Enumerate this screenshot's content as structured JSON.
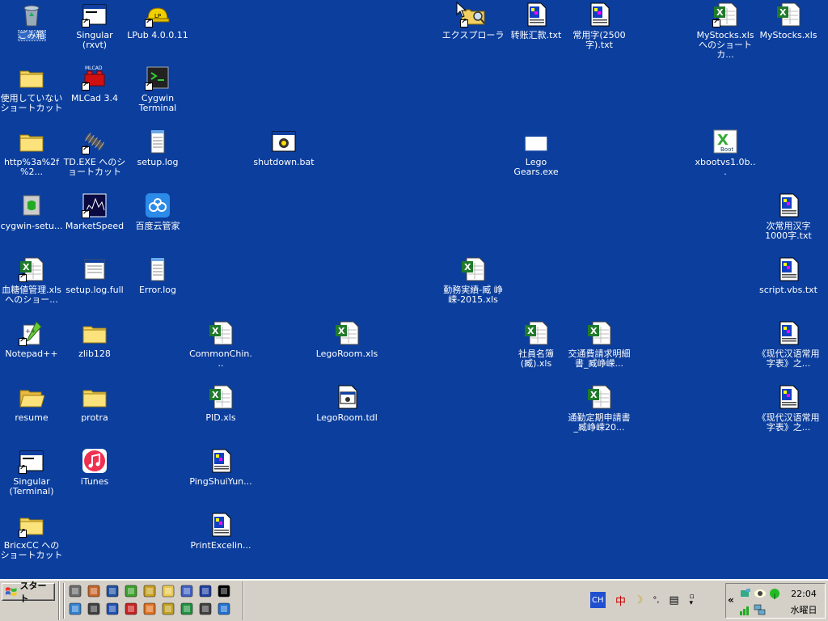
{
  "desktop": {
    "icons": [
      {
        "name": "recycle-bin",
        "label": "ごみ箱",
        "icon": "recycle-bin-icon",
        "col": 0,
        "row": 0,
        "shortcut": false,
        "selected": true
      },
      {
        "name": "singular-rxvt",
        "label": "Singular (rxvt)",
        "icon": "app-window-icon",
        "col": 1,
        "row": 0,
        "shortcut": true
      },
      {
        "name": "lpub",
        "label": "LPub 4.0.0.11",
        "icon": "hardhat-icon",
        "col": 2,
        "row": 0,
        "shortcut": true
      },
      {
        "name": "explorer",
        "label": "エクスプローラ",
        "icon": "explorer-icon",
        "col": 7,
        "row": 0,
        "shortcut": true
      },
      {
        "name": "zhuanzhang",
        "label": "转账汇款.txt",
        "icon": "text-doc-icon",
        "col": 8,
        "row": 0,
        "shortcut": false
      },
      {
        "name": "changyongzi",
        "label": "常用字(2500字).txt",
        "icon": "text-doc-icon",
        "col": 9,
        "row": 0,
        "shortcut": false
      },
      {
        "name": "mystocks-shortcut",
        "label": "MyStocks.xls へのショートカ...",
        "icon": "excel-doc-icon",
        "col": 11,
        "row": 0,
        "shortcut": true
      },
      {
        "name": "mystocks",
        "label": "MyStocks.xls",
        "icon": "excel-doc-icon",
        "col": 12,
        "row": 0,
        "shortcut": false
      },
      {
        "name": "unused-shortcuts",
        "label": "使用していないショートカット",
        "icon": "folder-icon",
        "col": 0,
        "row": 1,
        "shortcut": false
      },
      {
        "name": "mlcad",
        "label": "MLCad 3.4",
        "icon": "lego-brick-icon",
        "col": 1,
        "row": 1,
        "shortcut": true
      },
      {
        "name": "cygwin-terminal",
        "label": "Cygwin Terminal",
        "icon": "terminal-icon",
        "col": 2,
        "row": 1,
        "shortcut": true
      },
      {
        "name": "http-folder",
        "label": "http%3a%2f%2...",
        "icon": "folder-icon",
        "col": 0,
        "row": 2,
        "shortcut": false
      },
      {
        "name": "td-exe",
        "label": "TD.EXE へのショートカット",
        "icon": "track-icon",
        "col": 1,
        "row": 2,
        "shortcut": true
      },
      {
        "name": "setup-log",
        "label": "setup.log",
        "icon": "notepad-icon",
        "col": 2,
        "row": 2,
        "shortcut": false
      },
      {
        "name": "shutdown-bat",
        "label": "shutdown.bat",
        "icon": "batch-icon",
        "col": 4,
        "row": 2,
        "shortcut": false
      },
      {
        "name": "lego-gears",
        "label": "Lego Gears.exe",
        "icon": "blank-window-icon",
        "col": 8,
        "row": 2,
        "shortcut": false
      },
      {
        "name": "xboot",
        "label": "xbootvs1.0b...",
        "icon": "xboot-icon",
        "col": 11,
        "row": 2,
        "shortcut": false
      },
      {
        "name": "cygwin-setup",
        "label": "cygwin-setu...",
        "icon": "cygwin-setup-icon",
        "col": 0,
        "row": 3,
        "shortcut": false
      },
      {
        "name": "marketspeed",
        "label": "MarketSpeed",
        "icon": "chart-app-icon",
        "col": 1,
        "row": 3,
        "shortcut": true
      },
      {
        "name": "baidu-cloud",
        "label": "百度云管家",
        "icon": "cloud-icon",
        "col": 2,
        "row": 3,
        "shortcut": false
      },
      {
        "name": "ci-changyong",
        "label": "次常用汉字1000字.txt",
        "icon": "text-doc-icon",
        "col": 12,
        "row": 3,
        "shortcut": false
      },
      {
        "name": "blood-sugar",
        "label": "血糖値管理.xls へのショー...",
        "icon": "excel-doc-icon",
        "col": 0,
        "row": 4,
        "shortcut": true
      },
      {
        "name": "setup-log-full",
        "label": "setup.log.full",
        "icon": "notepad-window-icon",
        "col": 1,
        "row": 4,
        "shortcut": false
      },
      {
        "name": "error-log",
        "label": "Error.log",
        "icon": "notepad-icon",
        "col": 2,
        "row": 4,
        "shortcut": false
      },
      {
        "name": "attendance",
        "label": "勤務実績-臧 峥嵘-2015.xls",
        "icon": "excel-doc-icon",
        "col": 7,
        "row": 4,
        "shortcut": false
      },
      {
        "name": "script-vbs",
        "label": "script.vbs.txt",
        "icon": "text-doc-icon",
        "col": 12,
        "row": 4,
        "shortcut": false
      },
      {
        "name": "notepadpp",
        "label": "Notepad++",
        "icon": "notepadpp-icon",
        "col": 0,
        "row": 5,
        "shortcut": true
      },
      {
        "name": "zlib128",
        "label": "zlib128",
        "icon": "folder-icon",
        "col": 1,
        "row": 5,
        "shortcut": false
      },
      {
        "name": "commonchin",
        "label": "CommonChin...",
        "icon": "excel-doc-icon",
        "col": 3,
        "row": 5,
        "shortcut": false
      },
      {
        "name": "legoroom-xls",
        "label": "LegoRoom.xls",
        "icon": "excel-doc-icon",
        "col": 5,
        "row": 5,
        "shortcut": false
      },
      {
        "name": "employee-list",
        "label": "社員名簿(臧).xls",
        "icon": "excel-doc-icon",
        "col": 8,
        "row": 5,
        "shortcut": false
      },
      {
        "name": "transport-request",
        "label": "交通費請求明細書_臧峥嵘...",
        "icon": "excel-doc-icon",
        "col": 9,
        "row": 5,
        "shortcut": false
      },
      {
        "name": "xiandai-1",
        "label": "《现代汉语常用字表》之...",
        "icon": "text-doc-icon",
        "col": 12,
        "row": 5,
        "shortcut": false
      },
      {
        "name": "resume",
        "label": "resume",
        "icon": "open-folder-icon",
        "col": 0,
        "row": 6,
        "shortcut": false
      },
      {
        "name": "protra",
        "label": "protra",
        "icon": "folder-icon",
        "col": 1,
        "row": 6,
        "shortcut": false
      },
      {
        "name": "pid-xls",
        "label": "PID.xls",
        "icon": "excel-doc-icon",
        "col": 3,
        "row": 6,
        "shortcut": false
      },
      {
        "name": "legoroom-tdl",
        "label": "LegoRoom.tdl",
        "icon": "batch-doc-icon",
        "col": 5,
        "row": 6,
        "shortcut": false
      },
      {
        "name": "commute-pass",
        "label": "通勤定期申請書_臧峥嵘20...",
        "icon": "excel-doc-icon",
        "col": 9,
        "row": 6,
        "shortcut": false
      },
      {
        "name": "xiandai-2",
        "label": "《现代汉语常用字表》之...",
        "icon": "text-doc-icon",
        "col": 12,
        "row": 6,
        "shortcut": false
      },
      {
        "name": "singular-terminal",
        "label": "Singular (Terminal)",
        "icon": "app-window-icon",
        "col": 0,
        "row": 7,
        "shortcut": true
      },
      {
        "name": "itunes",
        "label": "iTunes",
        "icon": "itunes-icon",
        "col": 1,
        "row": 7,
        "shortcut": false
      },
      {
        "name": "pingshui",
        "label": "PingShuiYun...",
        "icon": "text-doc-icon",
        "col": 3,
        "row": 7,
        "shortcut": false
      },
      {
        "name": "bricxcc",
        "label": "BricxCC へのショートカット",
        "icon": "folder-icon",
        "col": 0,
        "row": 8,
        "shortcut": true
      },
      {
        "name": "printexcel",
        "label": "PrintExcelin...",
        "icon": "text-doc-icon",
        "col": 3,
        "row": 8,
        "shortcut": false
      }
    ]
  },
  "taskbar": {
    "start_label": "スタート",
    "quicklaunch": [
      {
        "icon": "gimp-icon",
        "color": "#6b6b6b"
      },
      {
        "icon": "package-icon",
        "color": "#c86428"
      },
      {
        "icon": "monitor-icon",
        "color": "#2050a0"
      },
      {
        "icon": "nvidia-icon",
        "color": "#3aa02a"
      },
      {
        "icon": "flowers-icon",
        "color": "#c8a020"
      },
      {
        "icon": "folder-ql-icon",
        "color": "#e8c850"
      },
      {
        "icon": "puzzle-icon",
        "color": "#4060c0"
      },
      {
        "icon": "vb-icon",
        "color": "#2040a0"
      },
      {
        "icon": "cmd-icon",
        "color": "#000000"
      },
      {
        "icon": "network-icon",
        "color": "#3080d0"
      },
      {
        "icon": "pen-icon",
        "color": "#404040"
      },
      {
        "icon": "cube-icon",
        "color": "#2050b0"
      },
      {
        "icon": "lego-ql-icon",
        "color": "#c82020"
      },
      {
        "icon": "firefox-icon",
        "color": "#e07020"
      },
      {
        "icon": "chip-icon",
        "color": "#c0a020"
      },
      {
        "icon": "cygwin-ql-icon",
        "color": "#209040"
      },
      {
        "icon": "window-ql-icon",
        "color": "#404040"
      },
      {
        "icon": "ie-icon",
        "color": "#2070d0"
      }
    ],
    "ime": {
      "lang": "CH",
      "mode": "中",
      "moon": "☽",
      "punct": "°,",
      "tool": "▤"
    },
    "tray": {
      "chevron": "«",
      "time": "22:04",
      "day": "水曜日"
    }
  }
}
